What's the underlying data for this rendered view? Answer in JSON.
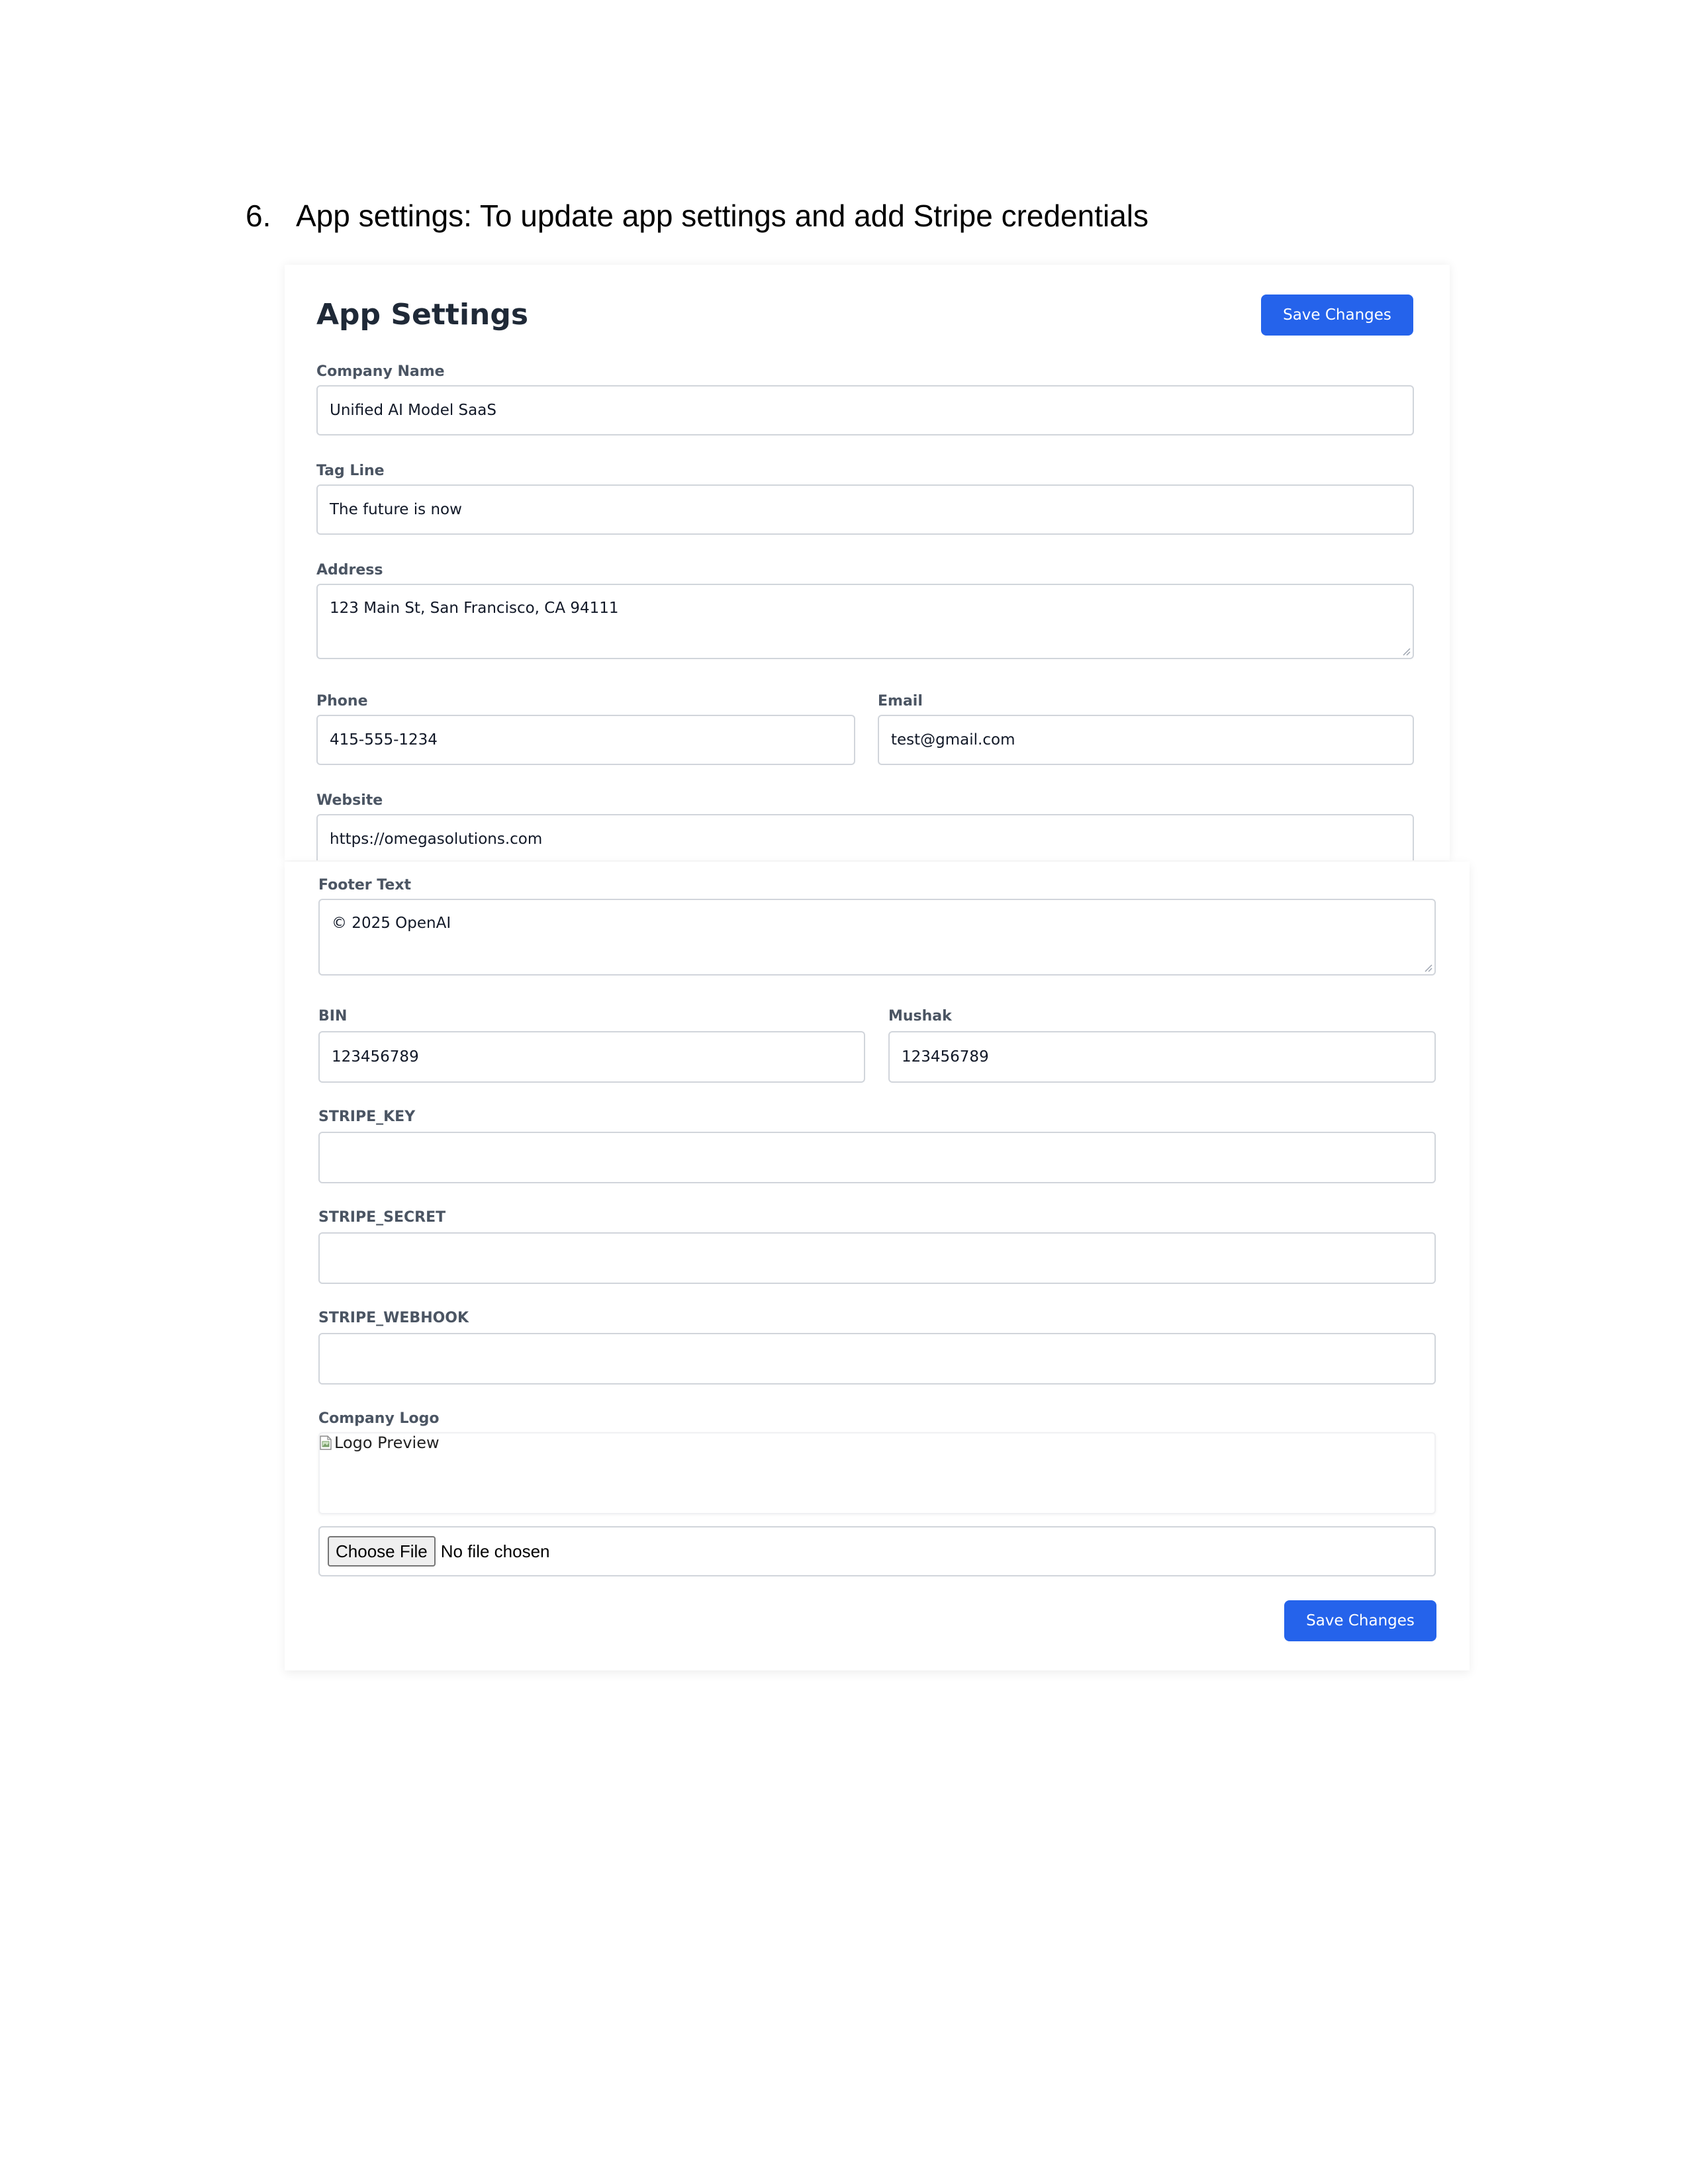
{
  "doc": {
    "step_number": "6.",
    "step_text": "App settings: To update app settings and add Stripe credentials"
  },
  "colors": {
    "primary_button": "#2563eb",
    "title_text": "#1f2937",
    "label_text": "#4b5563",
    "input_border": "#d1d5db"
  },
  "settings": {
    "title": "App Settings",
    "save_label": "Save Changes",
    "fields": {
      "company_name": {
        "label": "Company Name",
        "value": "Unified AI Model SaaS"
      },
      "tag_line": {
        "label": "Tag Line",
        "value": "The future is now"
      },
      "address": {
        "label": "Address",
        "value": "123 Main St, San Francisco, CA 94111"
      },
      "phone": {
        "label": "Phone",
        "value": "415-555-1234"
      },
      "email": {
        "label": "Email",
        "value": "test@gmail.com"
      },
      "website": {
        "label": "Website",
        "value": "https://omegasolutions.com"
      },
      "footer_text": {
        "label": "Footer Text",
        "value": "© 2025 OpenAI"
      },
      "bin": {
        "label": "BIN",
        "value": "123456789"
      },
      "mushak": {
        "label": "Mushak",
        "value": "123456789"
      },
      "stripe_key": {
        "label": "STRIPE_KEY",
        "value": ""
      },
      "stripe_secret": {
        "label": "STRIPE_SECRET",
        "value": ""
      },
      "stripe_webhook": {
        "label": "STRIPE_WEBHOOK",
        "value": ""
      }
    },
    "logo": {
      "label": "Company Logo",
      "preview_alt": "Logo Preview",
      "choose_file_label": "Choose File",
      "file_status": "No file chosen"
    }
  }
}
